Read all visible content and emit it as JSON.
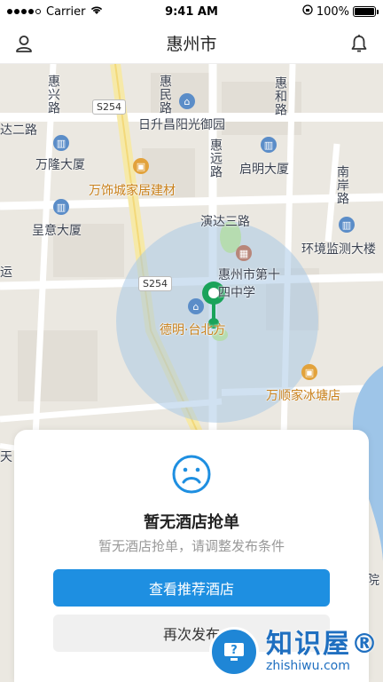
{
  "status_bar": {
    "carrier": "Carrier",
    "time": "9:41 AM",
    "battery_text": "100%"
  },
  "nav": {
    "title": "惠州市",
    "left_icon": "user-icon",
    "right_icon": "bell-icon"
  },
  "map": {
    "labels": {
      "huixing": "惠兴路",
      "huimin": "惠民路",
      "huihe": "惠和路",
      "dasi": "达二路",
      "richeng": "日升昌阳光御园",
      "wanlong": "万隆大厦",
      "huiyuan": "惠远路",
      "qiming": "启明大厦",
      "nanan": "南岸路",
      "wanshicheng": "万饰城家居建材",
      "yanda": "演达三路",
      "chengyi": "呈意大厦",
      "huanjing": "环境监测大楼",
      "yun": "运",
      "school": "惠州市第十四中学",
      "deming": "德明·台北方",
      "wanshun": "万顺家冰塘店",
      "tian": "天",
      "yuan": "院"
    },
    "road_signs": [
      "S254",
      "S254"
    ]
  },
  "panel": {
    "icon": "sad-face-icon",
    "title": "暂无酒店抢单",
    "subtitle": "暂无酒店抢单，请调整发布条件",
    "primary_button": "查看推荐酒店",
    "secondary_button": "再次发布"
  },
  "watermark": {
    "brand": "知识屋®",
    "url": "zhishiwu.com"
  },
  "colors": {
    "primary": "#1e8fe1",
    "pin": "#1aa35a",
    "radius_fill": "#a9c9e6"
  }
}
